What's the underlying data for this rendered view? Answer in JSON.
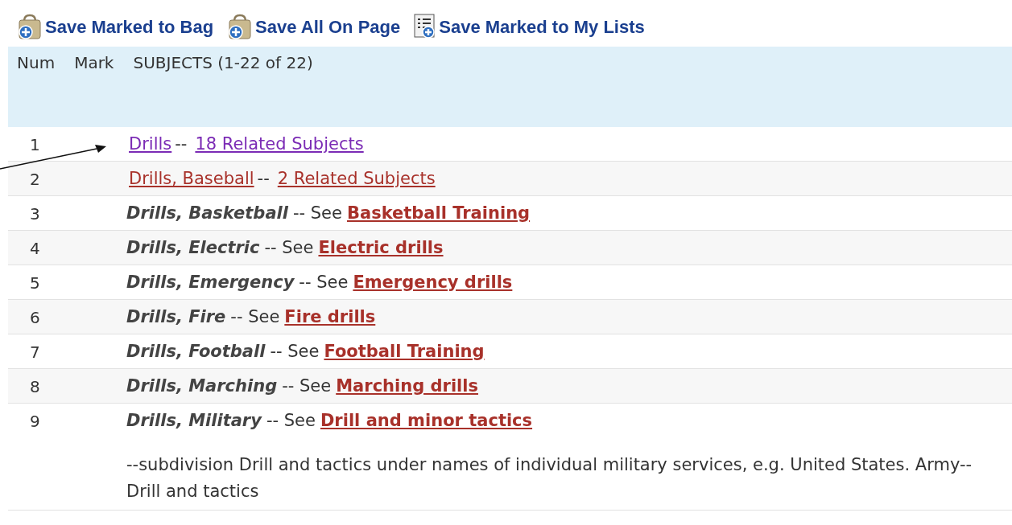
{
  "toolbar": [
    {
      "label": "Save Marked to Bag",
      "kind": "bag"
    },
    {
      "label": "Save All On Page",
      "kind": "bag"
    },
    {
      "label": "Save Marked to My Lists",
      "kind": "list"
    }
  ],
  "header": {
    "columns": [
      "Num",
      "Mark",
      "SUBJECTS (1-22 of 22)"
    ]
  },
  "rows": [
    {
      "num": "1",
      "kind": "subject",
      "heading": "Drills",
      "separator": "--",
      "link": "18 Related Subjects",
      "visited": true
    },
    {
      "num": "2",
      "kind": "subject",
      "heading": "Drills, Baseball",
      "separator": "--",
      "link": "2 Related Subjects",
      "visited": false
    },
    {
      "num": "3",
      "kind": "see",
      "heading": "Drills, Basketball",
      "separator": "-- See",
      "link": "Basketball Training"
    },
    {
      "num": "4",
      "kind": "see",
      "heading": "Drills, Electric",
      "separator": "-- See",
      "link": "Electric drills"
    },
    {
      "num": "5",
      "kind": "see",
      "heading": "Drills, Emergency",
      "separator": "-- See",
      "link": "Emergency drills"
    },
    {
      "num": "6",
      "kind": "see",
      "heading": "Drills, Fire",
      "separator": "-- See",
      "link": "Fire drills"
    },
    {
      "num": "7",
      "kind": "see",
      "heading": "Drills, Football",
      "separator": "-- See",
      "link": "Football Training"
    },
    {
      "num": "8",
      "kind": "see",
      "heading": "Drills, Marching",
      "separator": "-- See",
      "link": "Marching drills"
    },
    {
      "num": "9",
      "kind": "see",
      "heading": "Drills, Military",
      "separator": "-- See",
      "link": "Drill and minor tactics",
      "note": "--subdivision Drill and tactics under names of individual military services, e.g. United States. Army--Drill and tactics"
    }
  ]
}
